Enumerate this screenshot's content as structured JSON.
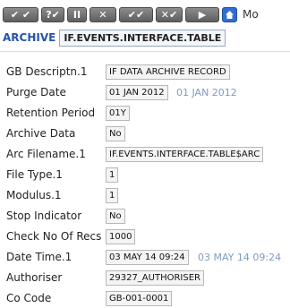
{
  "toolbar": {
    "buttons": [
      "✔ ✔",
      "?✔",
      "II",
      "✕",
      "✔✔",
      "✕✔",
      "▶"
    ],
    "mode_label": "Mo"
  },
  "breadcrumb": {
    "application": "ARCHIVE",
    "record_id": "IF.EVENTS.INTERFACE.TABLE"
  },
  "fields": [
    {
      "label": "GB Descriptn.1",
      "value": "IF DATA ARCHIVE RECORD",
      "enrichment": ""
    },
    {
      "label": "Purge Date",
      "value": "01 JAN 2012",
      "enrichment": "01 JAN 2012"
    },
    {
      "label": "Retention Period",
      "value": "01Y",
      "enrichment": ""
    },
    {
      "label": "Archive Data",
      "value": "No",
      "enrichment": ""
    },
    {
      "label": "Arc Filename.1",
      "value": "IF.EVENTS.INTERFACE.TABLE$ARC",
      "enrichment": ""
    },
    {
      "label": "File Type.1",
      "value": "1",
      "enrichment": ""
    },
    {
      "label": "Modulus.1",
      "value": "1",
      "enrichment": ""
    },
    {
      "label": "Stop Indicator",
      "value": "No",
      "enrichment": ""
    },
    {
      "label": "Check No Of Recs",
      "value": "1000",
      "enrichment": ""
    },
    {
      "label": "Date Time.1",
      "value": "03 MAY 14 09:24",
      "enrichment": "03 MAY 14 09:24"
    },
    {
      "label": "Authoriser",
      "value": "29327_AUTHORISER",
      "enrichment": ""
    },
    {
      "label": "Co Code",
      "value": "GB-001-0001",
      "enrichment": ""
    }
  ],
  "colors": {
    "breadcrumb_app": "#2255aa",
    "enrichment_text": "#7f9ac2",
    "toolbar_button": "#6e6e6e",
    "home_button": "#2f6fd1"
  },
  "icons": [
    "commit-icon",
    "validate-icon",
    "hold-icon",
    "delete-icon",
    "authorise-icon",
    "reverse-icon",
    "next-icon",
    "home-icon"
  ]
}
